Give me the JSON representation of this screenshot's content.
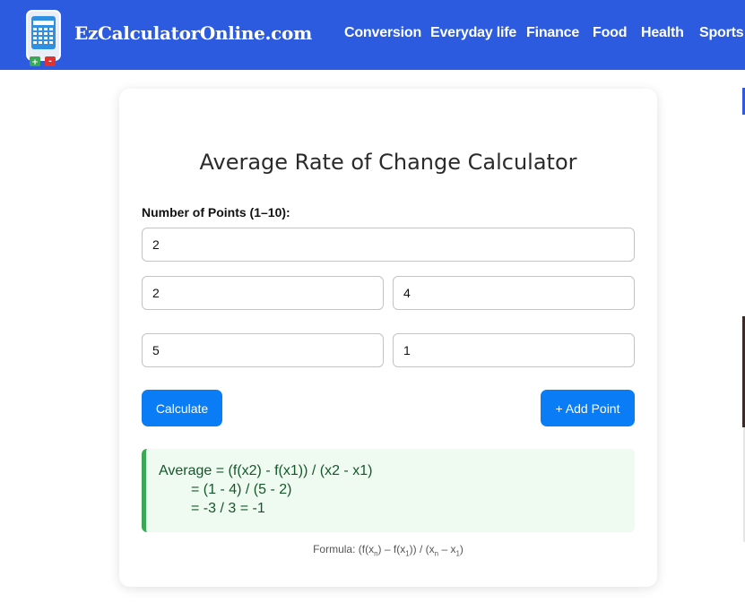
{
  "header": {
    "site_name": "EzCalculatorOnline.com",
    "nav": [
      "Conversion",
      "Everyday life",
      "Finance",
      "Food",
      "Health",
      "Sports"
    ],
    "logo_plus": "+",
    "logo_minus": "-"
  },
  "calculator": {
    "title": "Average Rate of Change Calculator",
    "points_label": "Number of Points (1–10):",
    "points_value": "2",
    "points": [
      {
        "x": "2",
        "y": "4"
      },
      {
        "x": "5",
        "y": "1"
      }
    ],
    "calculate_label": "Calculate",
    "add_point_label": "+ Add Point"
  },
  "result": {
    "line1": "Average = (f(x2) - f(x1)) / (x2 - x1)",
    "line2": "= (1 - 4) / (5 - 2)",
    "line3": "= -3 / 3 = -1"
  },
  "formula": {
    "prefix": "Formula: (f(x",
    "n1": "n",
    "part2": ") – f(x",
    "one1": "1",
    "part3": ")) / (x",
    "n2": "n",
    "part4": " – x",
    "one2": "1",
    "suffix": ")"
  },
  "colors": {
    "header_bg": "#2c5be0",
    "button_bg": "#0a7cf5",
    "result_bg": "#effaf1",
    "result_border": "#3aa856",
    "result_text": "#15572b"
  }
}
